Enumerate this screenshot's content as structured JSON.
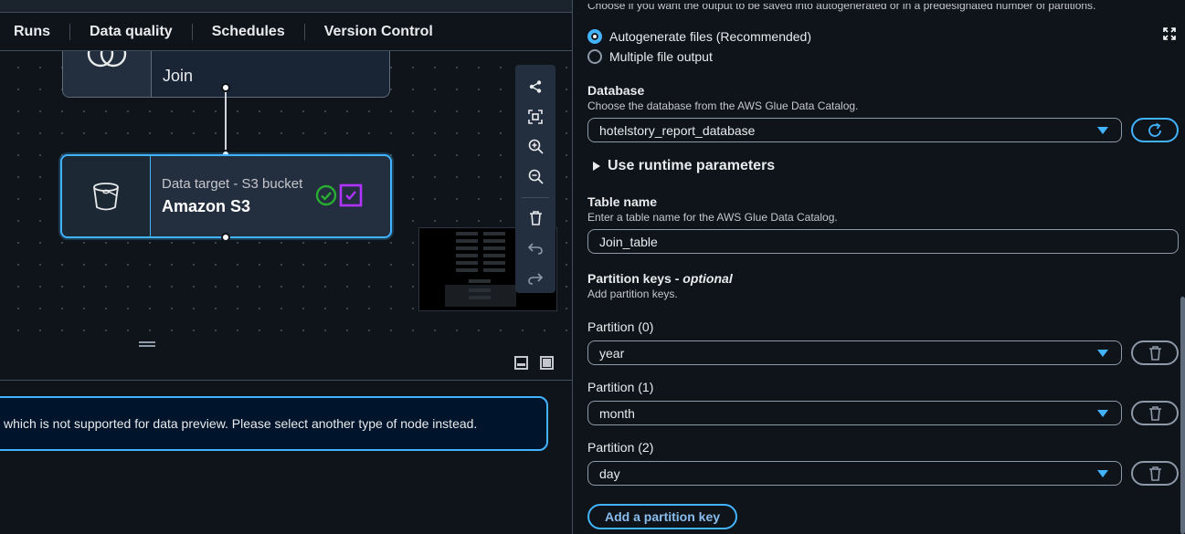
{
  "tabs": [
    "Runs",
    "Data quality",
    "Schedules",
    "Version Control"
  ],
  "canvas": {
    "join_node": {
      "title": "Join",
      "icon": "join-venn-icon"
    },
    "target_node": {
      "subtitle": "Data target - S3 bucket",
      "title": "Amazon S3",
      "icon": "s3-bucket-icon",
      "status_icons": [
        "check-circle-icon",
        "checkbox-checked-icon"
      ]
    },
    "toolbar_icons": [
      "layout-icon",
      "fit-view-icon",
      "zoom-in-icon",
      "zoom-out-icon",
      "delete-icon",
      "undo-icon",
      "redo-icon"
    ]
  },
  "preview": {
    "message": "which is not supported for data preview. Please select another type of node instead."
  },
  "form": {
    "partition_output_desc": "Choose if you want the output to be saved into autogenerated or in a predesignated number of partitions.",
    "radio_options": [
      {
        "label": "Autogenerate files (Recommended)",
        "checked": true
      },
      {
        "label": "Multiple file output",
        "checked": false
      }
    ],
    "database": {
      "label": "Database",
      "description": "Choose the database from the AWS Glue Data Catalog.",
      "value": "hotelstory_report_database"
    },
    "runtime_label": "Use runtime parameters",
    "table": {
      "label": "Table name",
      "description": "Enter a table name for the AWS Glue Data Catalog.",
      "value": "Join_table"
    },
    "partition_keys": {
      "label": "Partition keys",
      "optional": "optional",
      "description": "Add partition keys.",
      "items": [
        {
          "label": "Partition (0)",
          "value": "year"
        },
        {
          "label": "Partition (1)",
          "value": "month"
        },
        {
          "label": "Partition (2)",
          "value": "day"
        }
      ],
      "add_button": "Add a partition key"
    }
  },
  "colors": {
    "accent": "#42b4ff",
    "background": "#0f141a",
    "success": "#29ad32",
    "purple": "#b033ff"
  }
}
